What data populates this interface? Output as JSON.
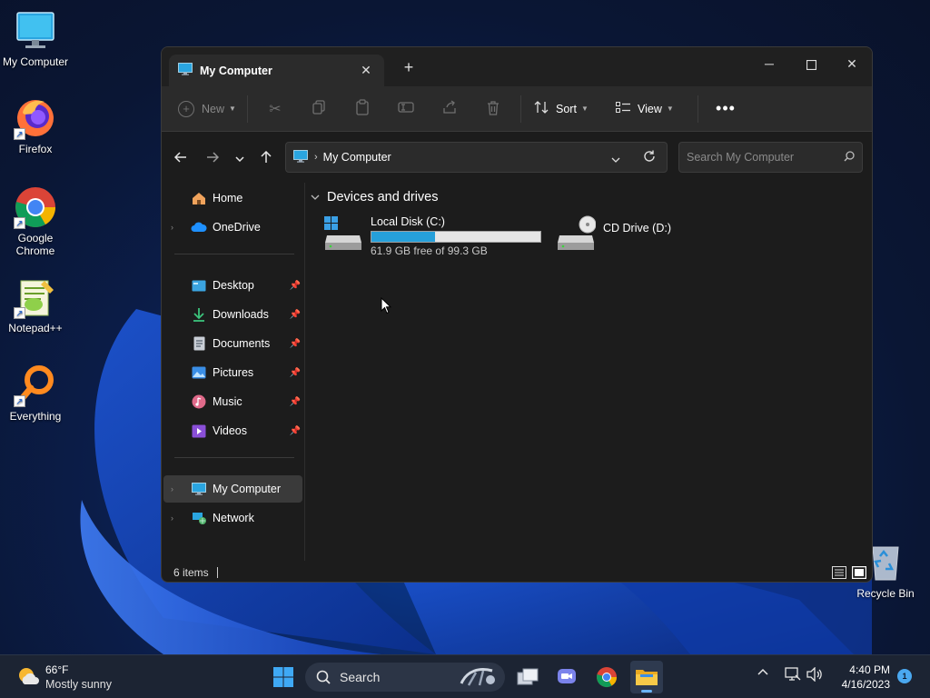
{
  "desktop": {
    "icons": [
      {
        "label": "My Computer",
        "icon": "monitor-icon"
      },
      {
        "label": "Firefox",
        "icon": "firefox-icon"
      },
      {
        "label": "Google Chrome",
        "icon": "chrome-icon"
      },
      {
        "label": "Notepad++",
        "icon": "notepadpp-icon"
      },
      {
        "label": "Everything",
        "icon": "everything-icon"
      }
    ],
    "recycle_bin": "Recycle Bin"
  },
  "window": {
    "tab_title": "My Computer",
    "toolbar": {
      "new_label": "New",
      "sort_label": "Sort",
      "view_label": "View"
    },
    "address": {
      "crumb": "My Computer",
      "search_placeholder": "Search My Computer"
    },
    "sidebar": {
      "items": [
        {
          "label": "Home",
          "icon": "home-icon"
        },
        {
          "label": "OneDrive",
          "icon": "cloud-icon"
        },
        {
          "label": "Desktop",
          "icon": "desktop-icon"
        },
        {
          "label": "Downloads",
          "icon": "download-icon"
        },
        {
          "label": "Documents",
          "icon": "document-icon"
        },
        {
          "label": "Pictures",
          "icon": "pictures-icon"
        },
        {
          "label": "Music",
          "icon": "music-icon"
        },
        {
          "label": "Videos",
          "icon": "videos-icon"
        },
        {
          "label": "My Computer",
          "icon": "monitor-icon"
        },
        {
          "label": "Network",
          "icon": "network-icon"
        }
      ]
    },
    "content": {
      "group_title": "Devices and drives",
      "drives": [
        {
          "name": "Local Disk (C:)",
          "free_text": "61.9 GB free of 99.3 GB",
          "used_fraction": 0.377
        },
        {
          "name": "CD Drive (D:)"
        }
      ]
    },
    "status": {
      "items_count": "6 items"
    }
  },
  "taskbar": {
    "weather_temp": "66°F",
    "weather_cond": "Mostly sunny",
    "search_label": "Search",
    "time": "4:40 PM",
    "date": "4/16/2023",
    "notification_count": "1"
  },
  "colors": {
    "accent": "#26a0da",
    "window_bg": "#1c1c1c",
    "taskbar_bg": "#1c2433"
  }
}
